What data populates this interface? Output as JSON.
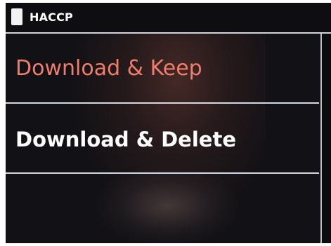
{
  "app": {
    "title": "HACCP",
    "icon": "document-icon"
  },
  "menu": {
    "items": [
      {
        "label": "Download & Keep",
        "selected": true,
        "color": "#ef7d6a"
      },
      {
        "label": "Download & Delete",
        "selected": false,
        "color": "#ffffff"
      },
      {
        "label": "",
        "selected": false
      }
    ]
  },
  "colors": {
    "background": "#121115",
    "divider": "#d4d8e0",
    "highlight_text": "#ef7d6a",
    "text": "#ffffff"
  }
}
